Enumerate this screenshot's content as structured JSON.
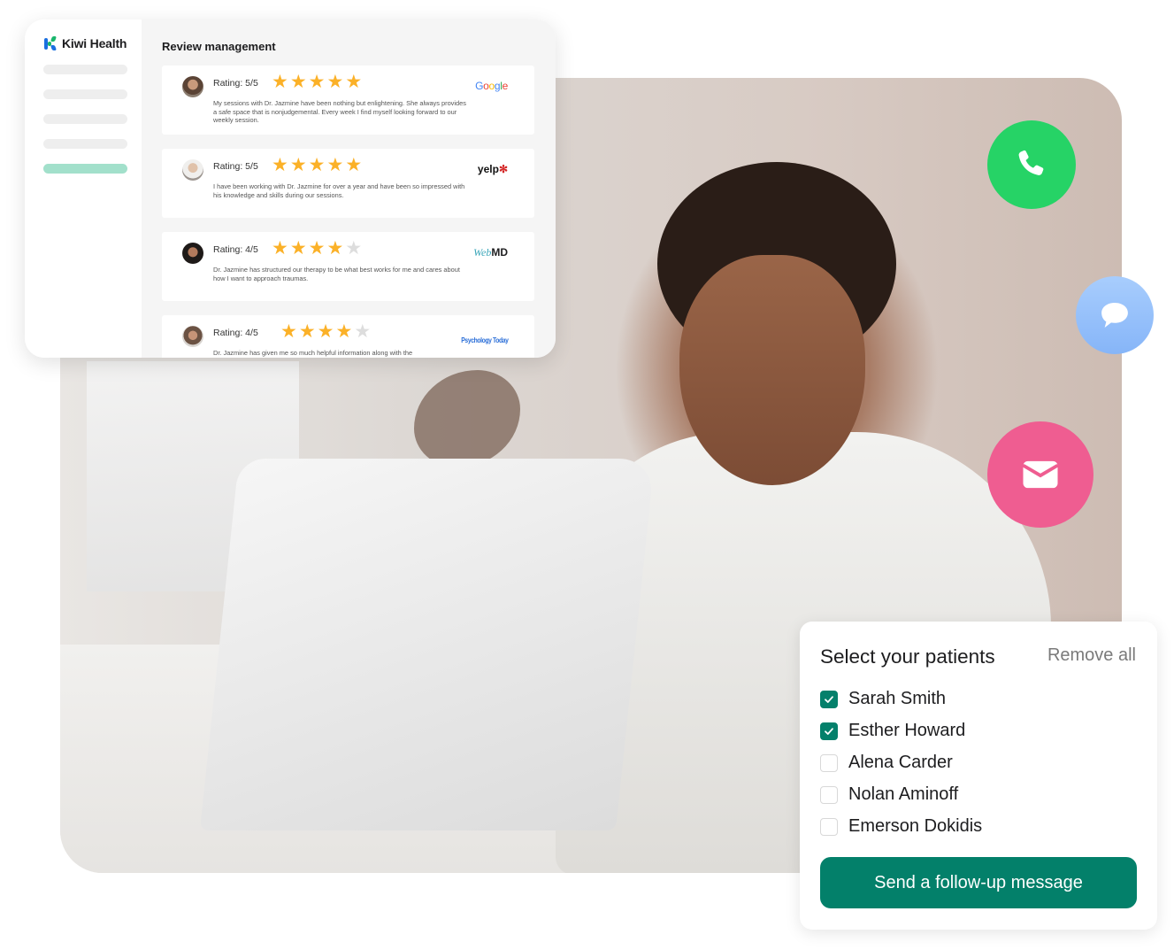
{
  "review_panel": {
    "brand_name": "Kiwi Health",
    "title": "Review management",
    "sidebar_items": [
      {
        "state": "inactive"
      },
      {
        "state": "inactive"
      },
      {
        "state": "inactive"
      },
      {
        "state": "inactive"
      },
      {
        "state": "active"
      }
    ],
    "reviews": [
      {
        "rating_label": "Rating: 5/5",
        "rating": 5,
        "max_rating": 5,
        "text": "My sessions with Dr. Jazmine have been nothing but enlightening. She always provides a safe space that is nonjudgemental. Every week I find myself looking forward to our weekly session.",
        "source": "Google"
      },
      {
        "rating_label": "Rating: 5/5",
        "rating": 5,
        "max_rating": 5,
        "text": "I have been working with Dr. Jazmine for over a year and have been so impressed with his knowledge and skills during our sessions.",
        "source": "yelp"
      },
      {
        "rating_label": "Rating: 4/5",
        "rating": 4,
        "max_rating": 5,
        "text": "Dr. Jazmine has structured our therapy to be what best works for me and cares about how I want to approach traumas.",
        "source": "WebMD"
      },
      {
        "rating_label": "Rating: 4/5",
        "rating": 4,
        "max_rating": 5,
        "text": "Dr. Jazmine has given me so much helpful information along with the",
        "source": "Psychology Today"
      }
    ]
  },
  "contact_buttons": [
    {
      "name": "phone",
      "icon": "phone-icon",
      "color": "#26d366"
    },
    {
      "name": "chat",
      "icon": "chat-bubble-icon",
      "color": "#95bffb"
    },
    {
      "name": "email",
      "icon": "envelope-icon",
      "color": "#ef5d91"
    }
  ],
  "patients_panel": {
    "title": "Select your patients",
    "remove_all_label": "Remove all",
    "patients": [
      {
        "name": "Sarah Smith",
        "checked": true
      },
      {
        "name": "Esther Howard",
        "checked": true
      },
      {
        "name": "Alena Carder",
        "checked": false
      },
      {
        "name": "Nolan Aminoff",
        "checked": false
      },
      {
        "name": "Emerson Dokidis",
        "checked": false
      }
    ],
    "send_button_label": "Send a follow-up message",
    "accent_color": "#03806a"
  }
}
